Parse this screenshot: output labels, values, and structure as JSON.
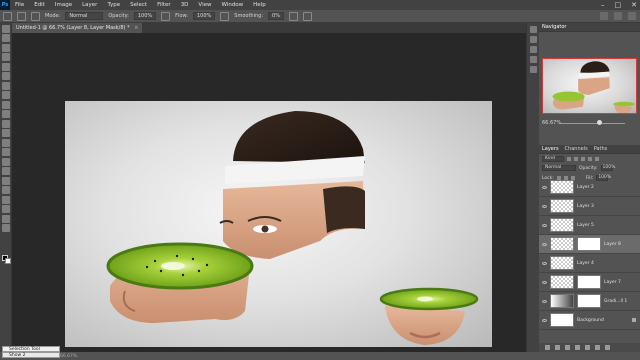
{
  "menu": {
    "logo": "Ps",
    "items": [
      "File",
      "Edit",
      "Image",
      "Layer",
      "Type",
      "Select",
      "Filter",
      "3D",
      "View",
      "Window",
      "Help"
    ],
    "window_controls": [
      "–",
      "□",
      "✕"
    ]
  },
  "options": {
    "mode_label": "Mode:",
    "mode_value": "Normal",
    "opacity_label": "Opacity:",
    "opacity_value": "100%",
    "flow_label": "Flow:",
    "flow_value": "100%",
    "smoothing_label": "Smoothing:",
    "smoothing_value": "0%"
  },
  "document": {
    "tab_label": "Untitled-1 @ 66.7% (Layer 8, Layer Mask/8) *",
    "close": "×"
  },
  "status": {
    "tooltip1": "Selection Tool",
    "tooltip2": "Show 2",
    "zoom": "66.67%"
  },
  "navigator": {
    "tabs": [
      "Navigator"
    ],
    "zoom": "66.67%"
  },
  "layers_panel": {
    "tabs": [
      "Layers",
      "Channels",
      "Paths"
    ],
    "kind_label": "Kind",
    "blend_mode": "Normal",
    "opacity_label": "Opacity:",
    "opacity_value": "100%",
    "fill_label": "Fill:",
    "fill_value": "100%",
    "lock_label": "Lock:",
    "layers": [
      {
        "name": "Layer 2",
        "mask": false,
        "selected": false
      },
      {
        "name": "Layer 3",
        "mask": false,
        "selected": false
      },
      {
        "name": "Layer 5",
        "mask": false,
        "selected": false
      },
      {
        "name": "Layer 8",
        "mask": true,
        "selected": true
      },
      {
        "name": "Layer 4",
        "mask": false,
        "selected": false
      },
      {
        "name": "Layer 7",
        "mask": true,
        "selected": false
      },
      {
        "name": "Gradi...ll 1",
        "mask": true,
        "selected": false
      },
      {
        "name": "Background",
        "mask": false,
        "selected": false
      }
    ]
  },
  "colors": {
    "accent_selection": "#d43b3b",
    "kiwi_green": "#8fbf2c",
    "kiwi_edge": "#4a7a12"
  }
}
